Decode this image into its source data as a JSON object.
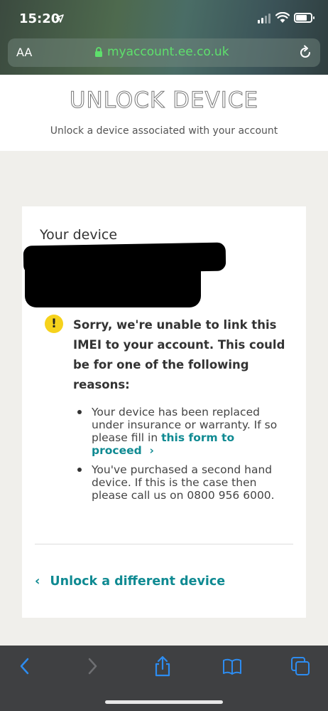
{
  "status_bar": {
    "time": "15:20"
  },
  "browser": {
    "text_size_label": "AA",
    "url": "myaccount.ee.co.uk"
  },
  "header": {
    "title": "UNLOCK DEVICE",
    "subtitle": "Unlock a device associated with your account"
  },
  "card": {
    "device_label": "Your device",
    "warning_text": "Sorry, we're unable to link this IMEI to your account. This could be for one of the following reasons:",
    "reason1_text": "Your device has been replaced under insurance or warranty. If so please fill in ",
    "reason1_link": "this form to proceed",
    "reason2_text": "You've purchased a second hand device. If this is the case then please call us on 0800 956 6000.",
    "back_link": "Unlock a different device"
  },
  "colors": {
    "link": "#0f8a92",
    "warning": "#f6d21c",
    "url_green": "#5ee06c",
    "toolbar_icon": "#2d8cf0"
  }
}
